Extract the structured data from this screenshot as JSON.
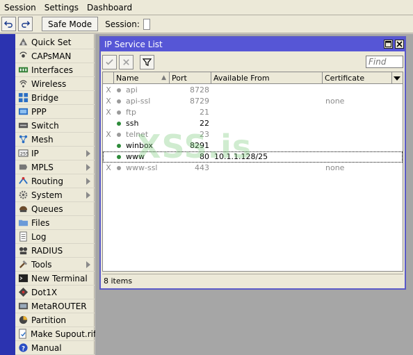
{
  "menubar": {
    "items": [
      "Session",
      "Settings",
      "Dashboard"
    ]
  },
  "toolbar": {
    "undo_icon": "undo-icon",
    "redo_icon": "redo-icon",
    "safe_mode": "Safe Mode",
    "session_label": "Session:"
  },
  "sidebar": {
    "items": [
      {
        "label": "Quick Set",
        "icon": "quickset-icon",
        "submenu": false
      },
      {
        "label": "CAPsMAN",
        "icon": "capsman-icon",
        "submenu": false
      },
      {
        "label": "Interfaces",
        "icon": "interfaces-icon",
        "submenu": false
      },
      {
        "label": "Wireless",
        "icon": "wireless-icon",
        "submenu": false
      },
      {
        "label": "Bridge",
        "icon": "bridge-icon",
        "submenu": false
      },
      {
        "label": "PPP",
        "icon": "ppp-icon",
        "submenu": false
      },
      {
        "label": "Switch",
        "icon": "switch-icon",
        "submenu": false
      },
      {
        "label": "Mesh",
        "icon": "mesh-icon",
        "submenu": false
      },
      {
        "label": "IP",
        "icon": "ip-icon",
        "submenu": true
      },
      {
        "label": "MPLS",
        "icon": "mpls-icon",
        "submenu": true
      },
      {
        "label": "Routing",
        "icon": "routing-icon",
        "submenu": true
      },
      {
        "label": "System",
        "icon": "system-icon",
        "submenu": true
      },
      {
        "label": "Queues",
        "icon": "queues-icon",
        "submenu": false
      },
      {
        "label": "Files",
        "icon": "files-icon",
        "submenu": false
      },
      {
        "label": "Log",
        "icon": "log-icon",
        "submenu": false
      },
      {
        "label": "RADIUS",
        "icon": "radius-icon",
        "submenu": false
      },
      {
        "label": "Tools",
        "icon": "tools-icon",
        "submenu": true
      },
      {
        "label": "New Terminal",
        "icon": "terminal-icon",
        "submenu": false
      },
      {
        "label": "Dot1X",
        "icon": "dot1x-icon",
        "submenu": false
      },
      {
        "label": "MetaROUTER",
        "icon": "metarouter-icon",
        "submenu": false
      },
      {
        "label": "Partition",
        "icon": "partition-icon",
        "submenu": false
      },
      {
        "label": "Make Supout.rif",
        "icon": "supout-icon",
        "submenu": false
      },
      {
        "label": "Manual",
        "icon": "manual-icon",
        "submenu": false
      }
    ]
  },
  "window": {
    "title": "IP Service List",
    "find_placeholder": "Find",
    "columns": [
      "Name",
      "Port",
      "Available From",
      "Certificate"
    ],
    "rows": [
      {
        "flag": "X",
        "name": "api",
        "port": "8728",
        "from": "",
        "cert": "",
        "disabled": true,
        "selected": false
      },
      {
        "flag": "X",
        "name": "api-ssl",
        "port": "8729",
        "from": "",
        "cert": "none",
        "disabled": true,
        "selected": false
      },
      {
        "flag": "X",
        "name": "ftp",
        "port": "21",
        "from": "",
        "cert": "",
        "disabled": true,
        "selected": false
      },
      {
        "flag": "",
        "name": "ssh",
        "port": "22",
        "from": "",
        "cert": "",
        "disabled": false,
        "selected": false
      },
      {
        "flag": "X",
        "name": "telnet",
        "port": "23",
        "from": "",
        "cert": "",
        "disabled": true,
        "selected": false
      },
      {
        "flag": "",
        "name": "winbox",
        "port": "8291",
        "from": "",
        "cert": "",
        "disabled": false,
        "selected": false
      },
      {
        "flag": "",
        "name": "www",
        "port": "80",
        "from": "10.1.1.128/25",
        "cert": "",
        "disabled": false,
        "selected": true
      },
      {
        "flag": "X",
        "name": "www-ssl",
        "port": "443",
        "from": "",
        "cert": "none",
        "disabled": true,
        "selected": false
      }
    ],
    "status": "8 items",
    "watermark": "XSS.is"
  },
  "colors": {
    "rail": "#2b33b0",
    "titlebar": "#5656d6",
    "enabled_dot": "#2e8b3a",
    "disabled_dot": "#9a9a9a"
  }
}
